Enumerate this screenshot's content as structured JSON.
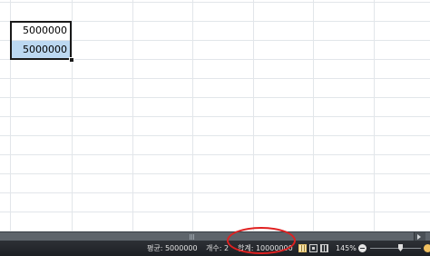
{
  "sheet": {
    "cells": [
      {
        "ref": "A1",
        "value": "5000000",
        "selected": true
      },
      {
        "ref": "A2",
        "value": "5000000",
        "selected": true,
        "highlighted": true
      }
    ]
  },
  "statusbar": {
    "average": "평균: 5000000",
    "count": "개수: 2",
    "sum": "합계: 10000000",
    "zoom": "145%"
  },
  "colors": {
    "selection_fill": "#bcd8f1",
    "statusbar_bg": "#1d2024",
    "annotation_circle": "#e02020",
    "gridline": "#e2e6ea"
  },
  "icons": [
    "normal-view-icon",
    "page-layout-view-icon",
    "page-break-view-icon",
    "zoom-out-icon",
    "zoom-in-icon",
    "scroll-right-icon"
  ]
}
